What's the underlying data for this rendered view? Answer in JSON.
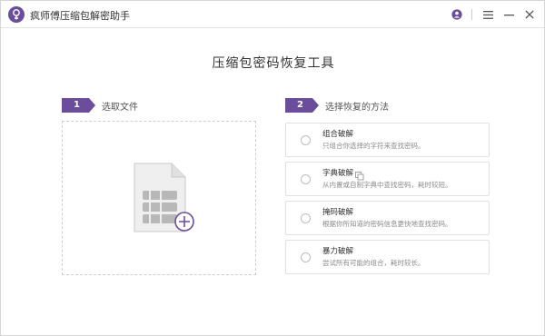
{
  "window": {
    "title": "疯师傅压缩包解密助手",
    "icons": [
      "user-icon",
      "menu-icon",
      "minimize-icon",
      "close-icon"
    ]
  },
  "main_title": "压缩包密码恢复工具",
  "steps": [
    {
      "number": "1",
      "label": "选取文件"
    },
    {
      "number": "2",
      "label": "选择恢复的方法"
    }
  ],
  "dropzone": {
    "icon": "archive-file-add-icon"
  },
  "methods": [
    {
      "title": "组合破解",
      "desc": "只组合你选择的字符来查找密码。"
    },
    {
      "title": "字典破解",
      "desc": "从内置或自制字典中查找密码，耗时较短。",
      "icon": "copy-icon"
    },
    {
      "title": "掩码破解",
      "desc": "根据你所知道的密码信息更快地查找密码。"
    },
    {
      "title": "暴力破解",
      "desc": "尝试所有可能的组合，耗时较长。"
    }
  ],
  "colors": {
    "accent": "#6a4e9c",
    "border": "#e1e1e1",
    "dash": "#cfcfcf"
  }
}
